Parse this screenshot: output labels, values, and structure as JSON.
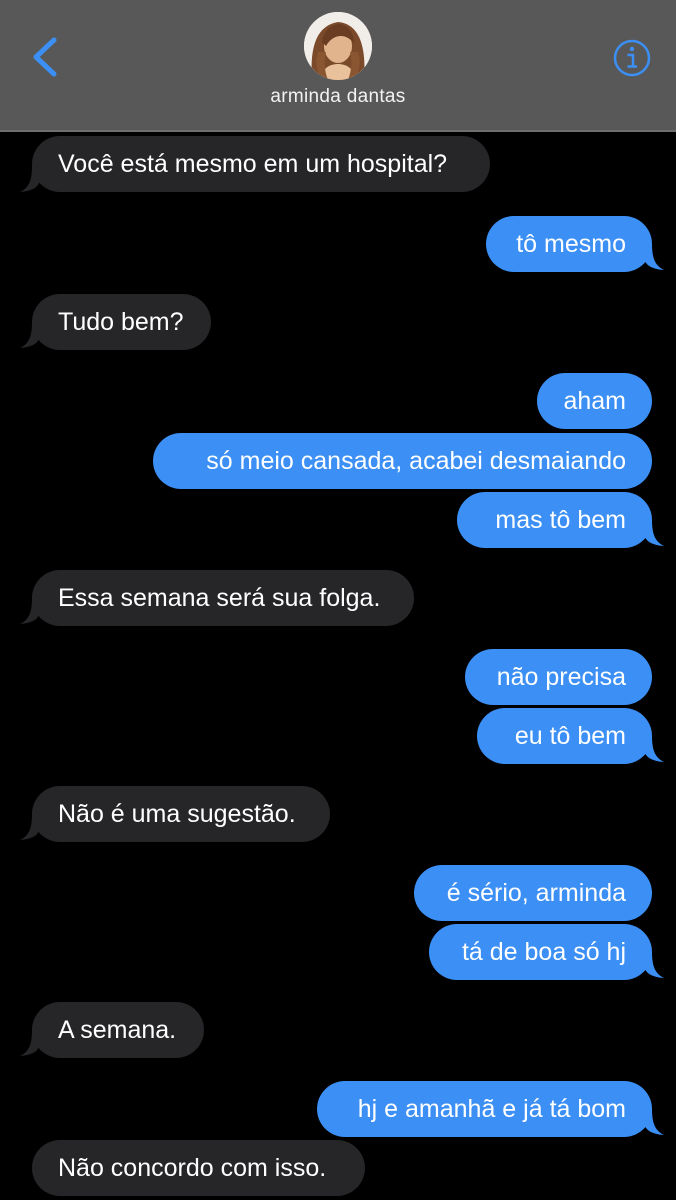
{
  "header": {
    "contact_name": "arminda dantas",
    "back_icon": "chevron-left-icon",
    "info_icon": "info-circle-icon"
  },
  "colors": {
    "accent": "#3b8ff5",
    "incoming_bubble": "#262629",
    "header_bg": "#585858",
    "background": "#000000"
  },
  "messages": [
    {
      "sender": "them",
      "text": "Você está mesmo em um hospital?"
    },
    {
      "sender": "me",
      "text": "tô mesmo"
    },
    {
      "sender": "them",
      "text": "Tudo bem?"
    },
    {
      "sender": "me",
      "text": "aham"
    },
    {
      "sender": "me",
      "text": "só meio cansada, acabei desmaiando"
    },
    {
      "sender": "me",
      "text": "mas tô bem"
    },
    {
      "sender": "them",
      "text": "Essa semana será sua folga."
    },
    {
      "sender": "me",
      "text": "não precisa"
    },
    {
      "sender": "me",
      "text": "eu tô bem"
    },
    {
      "sender": "them",
      "text": "Não é uma sugestão."
    },
    {
      "sender": "me",
      "text": "é sério, arminda"
    },
    {
      "sender": "me",
      "text": "tá de boa só hj"
    },
    {
      "sender": "them",
      "text": "A semana."
    },
    {
      "sender": "me",
      "text": "hj e amanhã e já tá bom"
    },
    {
      "sender": "them",
      "text": "Não concordo com isso."
    }
  ]
}
